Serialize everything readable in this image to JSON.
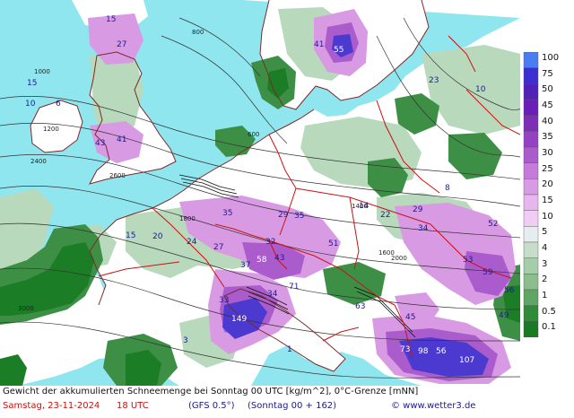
{
  "caption": "Gewicht der akkumulierten Schneemenge bei Sonntag 00 UTC [kg/m^2], 0°C-Grenze [mNN]",
  "run_info": {
    "date": "Samstag, 23-11-2024",
    "time": "18 UTC",
    "model": "(GFS 0.5°)",
    "valid": "(Sonntag 00 + 162)",
    "copyright": "© www.wetter3.de"
  },
  "legend": {
    "labels": [
      "100",
      "75",
      "50",
      "45",
      "40",
      "35",
      "30",
      "25",
      "20",
      "15",
      "10",
      "5",
      "4",
      "3",
      "2",
      "1",
      "0.5",
      "0.1"
    ],
    "colors": [
      "#4a7ef0",
      "#3b2fd0",
      "#5320b8",
      "#6b1fb8",
      "#7d2eb6",
      "#9441c2",
      "#ab5ccc",
      "#c57bd9",
      "#d99ae4",
      "#e8b6ee",
      "#f1cdf3",
      "#e6ecef",
      "#c7dcc9",
      "#a6cda9",
      "#8bbd8d",
      "#5fa563",
      "#2f8b37",
      "#187a22"
    ]
  },
  "colors": {
    "sea": "#8fe6ef",
    "land_snowfree": "#ffffff",
    "light_snow": "#b9d9bd",
    "snow_mid": "#3e8f46",
    "snow_dark": "#1b7d25",
    "heavy_snow": "#d07ad9",
    "very_heavy": "#4b39d0",
    "border": "#cc1111",
    "coast": "#7a2a2a",
    "isoline": "#333333",
    "footer_date": "#cc1111",
    "footer_info": "#1a1a8c"
  },
  "map_labels": [
    {
      "t": "41"
    },
    {
      "t": "55"
    },
    {
      "t": "27"
    },
    {
      "t": "15"
    },
    {
      "t": "15"
    },
    {
      "t": "10"
    },
    {
      "t": "43"
    },
    {
      "t": "41"
    },
    {
      "t": "23"
    },
    {
      "t": "10"
    },
    {
      "t": "35"
    },
    {
      "t": "29"
    },
    {
      "t": "29"
    },
    {
      "t": "35"
    },
    {
      "t": "34"
    },
    {
      "t": "52"
    },
    {
      "t": "20"
    },
    {
      "t": "15"
    },
    {
      "t": "24"
    },
    {
      "t": "27"
    },
    {
      "t": "37"
    },
    {
      "t": "58"
    },
    {
      "t": "43"
    },
    {
      "t": "32"
    },
    {
      "t": "51"
    },
    {
      "t": "33"
    },
    {
      "t": "34"
    },
    {
      "t": "71"
    },
    {
      "t": "149"
    },
    {
      "t": "63"
    },
    {
      "t": "53"
    },
    {
      "t": "59"
    },
    {
      "t": "56"
    },
    {
      "t": "73"
    },
    {
      "t": "98"
    },
    {
      "t": "56"
    },
    {
      "t": "107"
    },
    {
      "t": "45"
    },
    {
      "t": "49"
    },
    {
      "t": "14"
    },
    {
      "t": "22"
    },
    {
      "t": "6"
    },
    {
      "t": "8"
    },
    {
      "t": "3"
    },
    {
      "t": "1"
    }
  ],
  "freezing_labels": [
    "600",
    "800",
    "1000",
    "1200",
    "1400",
    "1600",
    "1800",
    "2000",
    "2400",
    "2600",
    "3000"
  ]
}
